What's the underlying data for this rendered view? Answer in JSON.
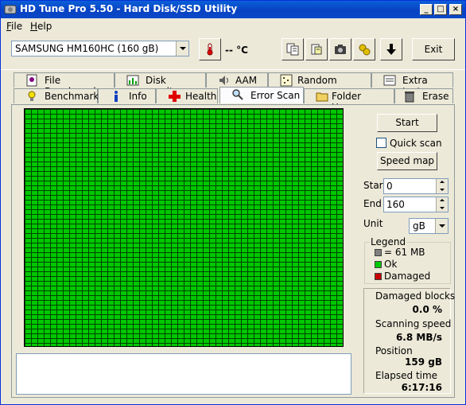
{
  "window": {
    "title": "HD Tune Pro 5.50 - Hard Disk/SSD Utility",
    "controls": {
      "minimize": "_",
      "maximize": "□",
      "close": "×"
    }
  },
  "menu": [
    {
      "label": "File",
      "accel": "F",
      "rest": "ile"
    },
    {
      "label": "Help",
      "accel": "H",
      "rest": "elp"
    }
  ],
  "toolbar": {
    "drive": "SAMSUNG HM160HC (160 gB)",
    "temperature": "-- °C",
    "exit_label": "Exit",
    "icons": [
      "thermometer-icon",
      "copy-info-icon",
      "copy-screenshot-icon",
      "camera-icon",
      "options-icon",
      "save-download-icon"
    ]
  },
  "tabs_top": [
    {
      "label": "File Benchmark",
      "icon": "file-benchmark-icon"
    },
    {
      "label": "Disk monitor",
      "icon": "disk-monitor-icon"
    },
    {
      "label": "AAM",
      "icon": "speaker-icon"
    },
    {
      "label": "Random Access",
      "icon": "random-access-icon"
    },
    {
      "label": "Extra tests",
      "icon": "extra-tests-icon"
    }
  ],
  "tabs_bottom": [
    {
      "label": "Benchmark",
      "icon": "lightbulb-icon"
    },
    {
      "label": "Info",
      "icon": "info-icon"
    },
    {
      "label": "Health",
      "icon": "health-cross-icon"
    },
    {
      "label": "Error Scan",
      "icon": "magnifier-icon",
      "active": true
    },
    {
      "label": "Folder Usage",
      "icon": "folder-icon"
    },
    {
      "label": "Erase",
      "icon": "trash-icon"
    }
  ],
  "error_scan": {
    "start_button": "Start",
    "quick_scan_label": "Quick scan",
    "quick_scan_checked": false,
    "speed_map_button": "Speed map",
    "start_label": "Start",
    "start_value": "0",
    "end_label": "End",
    "end_value": "160",
    "unit_label": "Unit",
    "unit_value": "gB",
    "legend": {
      "title": "Legend",
      "items": [
        {
          "label": "= 61 MB",
          "color": "#808080"
        },
        {
          "label": "Ok",
          "color": "#00c800"
        },
        {
          "label": "Damaged",
          "color": "#c80000"
        }
      ]
    },
    "stats": {
      "damaged_blocks_label": "Damaged blocks",
      "damaged_blocks_value": "0.0 %",
      "scanning_speed_label": "Scanning speed",
      "scanning_speed_value": "6.8 MB/s",
      "position_label": "Position",
      "position_value": "159 gB",
      "elapsed_label": "Elapsed time",
      "elapsed_value": "6:17:16"
    },
    "grid_color": "#00c800"
  }
}
